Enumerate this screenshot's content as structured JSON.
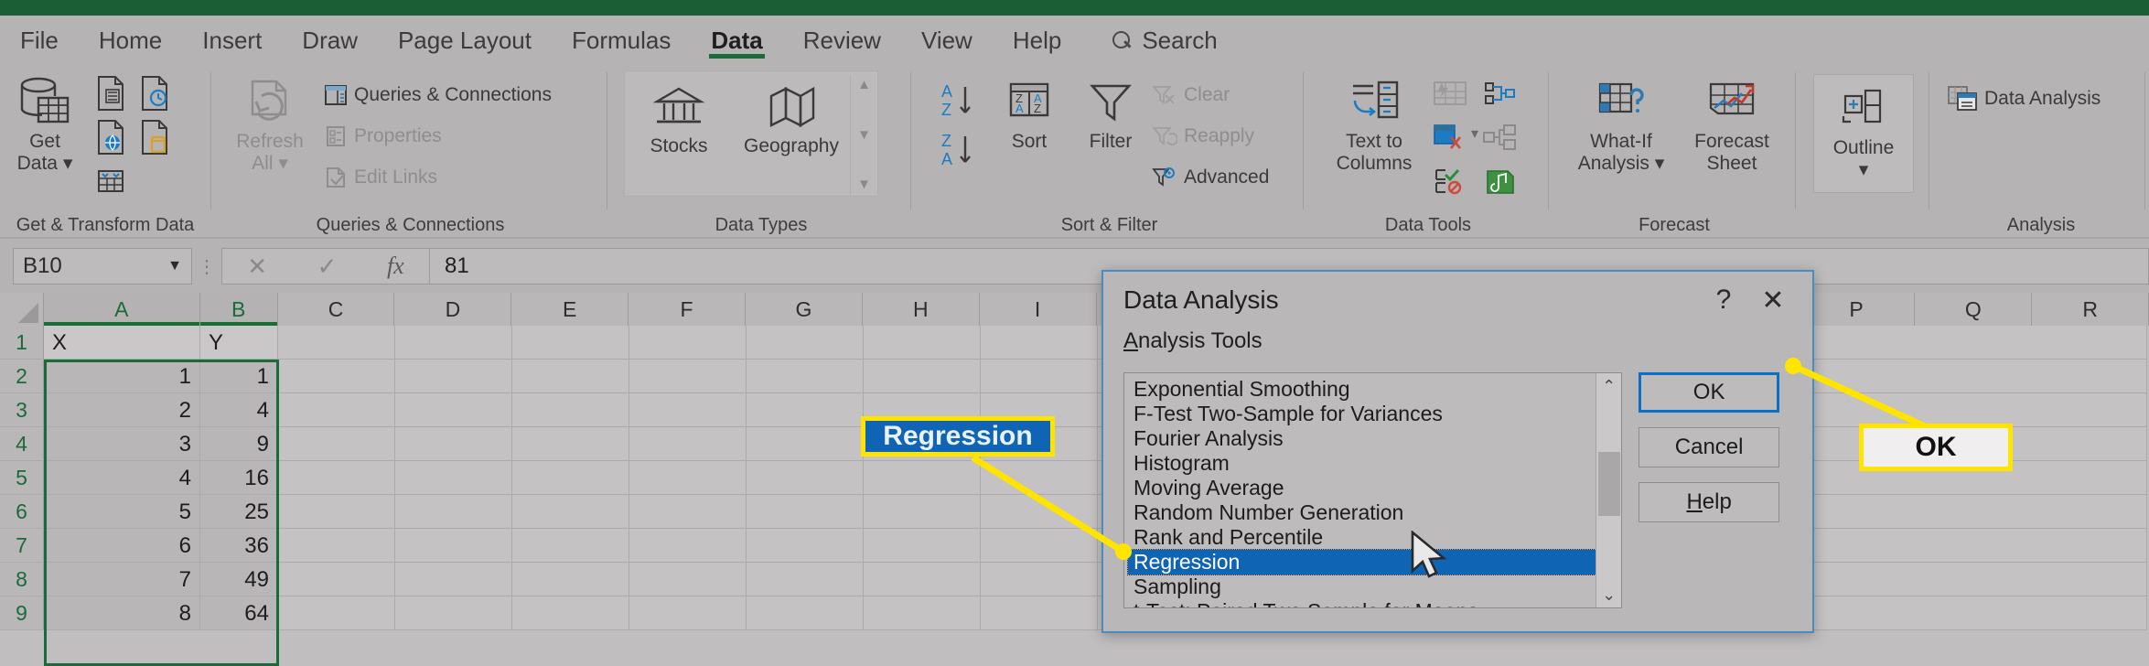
{
  "app": {
    "name": "Microsoft Excel",
    "accent_green": "#1b5e36",
    "chrome_gray": "#b5b3b3",
    "highlight_blue": "#0f64b4",
    "annotation_yellow": "#ffe400"
  },
  "ribbon": {
    "tabs": [
      {
        "label": "File",
        "active": false
      },
      {
        "label": "Home",
        "active": false
      },
      {
        "label": "Insert",
        "active": false
      },
      {
        "label": "Draw",
        "active": false
      },
      {
        "label": "Page Layout",
        "active": false
      },
      {
        "label": "Formulas",
        "active": false
      },
      {
        "label": "Data",
        "active": true
      },
      {
        "label": "Review",
        "active": false
      },
      {
        "label": "View",
        "active": false
      },
      {
        "label": "Help",
        "active": false
      }
    ],
    "search_label": "Search",
    "groups": [
      {
        "label": "Get & Transform Data",
        "buttons": [
          {
            "label": "Get\nData ▾",
            "name": "get-data-button"
          },
          {
            "label": "",
            "name": "from-text-csv-button"
          },
          {
            "label": "",
            "name": "from-web-button"
          },
          {
            "label": "",
            "name": "from-table-range-button"
          },
          {
            "label": "",
            "name": "recent-sources-button"
          },
          {
            "label": "",
            "name": "existing-connections-button"
          }
        ]
      },
      {
        "label": "Queries & Connections",
        "refresh_all": "Refresh\nAll ▾",
        "items": [
          {
            "label": "Queries & Connections",
            "enabled": true
          },
          {
            "label": "Properties",
            "enabled": false
          },
          {
            "label": "Edit Links",
            "enabled": false
          }
        ]
      },
      {
        "label": "Data Types",
        "items": [
          {
            "label": "Stocks"
          },
          {
            "label": "Geography"
          }
        ]
      },
      {
        "label": "Sort & Filter",
        "items": [
          {
            "label": "Sort"
          },
          {
            "label": "Filter"
          },
          {
            "label": "Clear",
            "enabled": false
          },
          {
            "label": "Reapply",
            "enabled": false
          },
          {
            "label": "Advanced",
            "enabled": true
          }
        ],
        "sort_az": "A↓ Z",
        "sort_za": "Z↓ A"
      },
      {
        "label": "Data Tools",
        "items": [
          {
            "label": "Text to\nColumns"
          }
        ]
      },
      {
        "label": "Forecast",
        "items": [
          {
            "label": "What-If\nAnalysis ▾"
          },
          {
            "label": "Forecast\nSheet"
          }
        ]
      },
      {
        "label": "",
        "items": [
          {
            "label": "Outline\n▾"
          }
        ]
      },
      {
        "label": "Analysis",
        "items": [
          {
            "label": "Data Analysis"
          }
        ]
      }
    ]
  },
  "formula_bar": {
    "name_box_value": "B10",
    "cancel_symbol": "✕",
    "enter_symbol": "✓",
    "fx_symbol": "fx",
    "value": "81"
  },
  "sheet": {
    "column_headers": [
      "A",
      "B",
      "C",
      "D",
      "E",
      "F",
      "G",
      "H",
      "I",
      "P",
      "Q",
      "R"
    ],
    "selected_columns": [
      "A",
      "B"
    ],
    "row_headers": [
      "1",
      "2",
      "3",
      "4",
      "5",
      "6",
      "7",
      "8",
      "9"
    ],
    "rows": [
      {
        "header": "1",
        "a": "X",
        "b": "Y",
        "is_header_row": true
      },
      {
        "header": "2",
        "a": "1",
        "b": "1"
      },
      {
        "header": "3",
        "a": "2",
        "b": "4"
      },
      {
        "header": "4",
        "a": "3",
        "b": "9"
      },
      {
        "header": "5",
        "a": "4",
        "b": "16"
      },
      {
        "header": "6",
        "a": "5",
        "b": "25"
      },
      {
        "header": "7",
        "a": "6",
        "b": "36"
      },
      {
        "header": "8",
        "a": "7",
        "b": "49"
      },
      {
        "header": "9",
        "a": "8",
        "b": "64"
      }
    ]
  },
  "dialog": {
    "title": "Data Analysis",
    "help_symbol": "?",
    "close_symbol": "✕",
    "section_label_prefix": "A",
    "section_label_rest": "nalysis Tools",
    "items": [
      {
        "label": "Exponential Smoothing",
        "selected": false
      },
      {
        "label": "F-Test Two-Sample for Variances",
        "selected": false
      },
      {
        "label": "Fourier Analysis",
        "selected": false
      },
      {
        "label": "Histogram",
        "selected": false
      },
      {
        "label": "Moving Average",
        "selected": false
      },
      {
        "label": "Random Number Generation",
        "selected": false
      },
      {
        "label": "Rank and Percentile",
        "selected": false
      },
      {
        "label": "Regression",
        "selected": true
      },
      {
        "label": "Sampling",
        "selected": false
      },
      {
        "label": "t-Test: Paired Two Sample for Means",
        "selected": false
      }
    ],
    "scroll_up_symbol": "⌃",
    "scroll_down_symbol": "⌄",
    "buttons": {
      "ok": "OK",
      "cancel": "Cancel",
      "help_prefix": "H",
      "help_rest": "elp"
    }
  },
  "annotations": [
    {
      "name": "regression-callout",
      "text": "Regression",
      "style": "highlight"
    },
    {
      "name": "ok-callout",
      "text": "OK",
      "style": "plain"
    }
  ]
}
